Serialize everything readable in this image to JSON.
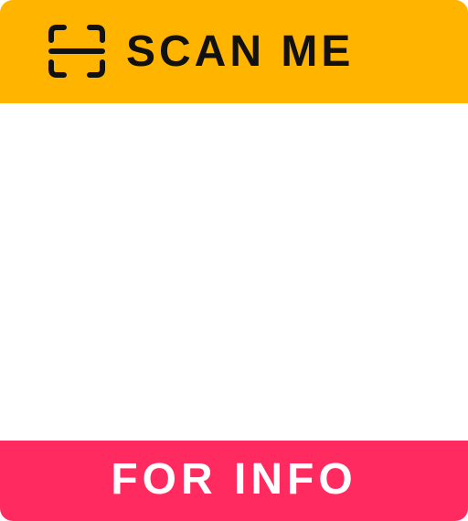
{
  "header": {
    "title": "SCAN ME",
    "icon": "scan-frame-icon",
    "background": "#FFB400",
    "text_color": "#111111"
  },
  "qr_area": {
    "background": "#FFFFFF"
  },
  "footer": {
    "label": "FOR INFO",
    "background": "#FF2A5F",
    "text_color": "#FFFFFF"
  }
}
